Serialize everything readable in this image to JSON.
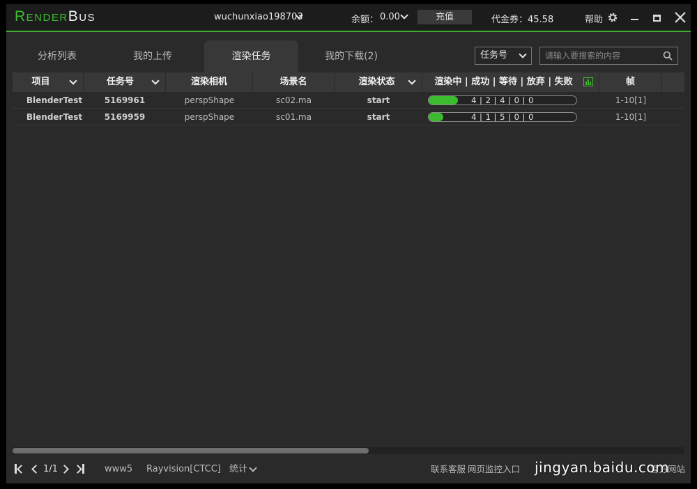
{
  "app": {
    "logo_prefix": "Render",
    "logo_suffix": "Bus",
    "accent": "#3dbb2f"
  },
  "titlebar": {
    "username": "wuchunxiao198703",
    "balance_label": "余额：",
    "balance_value": "0.00",
    "recharge_label": "充值",
    "coupon": "代金券：45.58",
    "help": "帮助"
  },
  "tabs": [
    {
      "label": "分析列表",
      "active": false
    },
    {
      "label": "我的上传",
      "active": false
    },
    {
      "label": "渲染任务",
      "active": true
    },
    {
      "label": "我的下载(2)",
      "active": false
    }
  ],
  "search": {
    "field": "任务号",
    "placeholder": "请输入要搜索的内容"
  },
  "table": {
    "headers": [
      "项目",
      "任务号",
      "渲染相机",
      "场景名",
      "渲染状态",
      "渲染中 | 成功 | 等待 | 放弃 | 失败",
      "帧"
    ],
    "rows": [
      {
        "project": "BlenderTest",
        "task_id": "5169961",
        "camera": "perspShape",
        "scene": "sc02.ma",
        "status": "start",
        "counts": "4 | 2 | 4 | 0 | 0",
        "progress": 0.2,
        "frames": "1-10[1]"
      },
      {
        "project": "BlenderTest",
        "task_id": "5169959",
        "camera": "perspShape",
        "scene": "sc01.ma",
        "status": "start",
        "counts": "4 | 1 | 5 | 0 | 0",
        "progress": 0.1,
        "frames": "1-10[1]"
      }
    ]
  },
  "scroll": {
    "horizontal_fraction": 0.53
  },
  "footer": {
    "page": "1/1",
    "user": "www5",
    "platform": "Rayvision[CTCC]",
    "stats": "统计",
    "support": "联系客服",
    "monitor": "网页监控入口",
    "official": "官方网站",
    "watermark": "jingyan.baidu.com"
  }
}
